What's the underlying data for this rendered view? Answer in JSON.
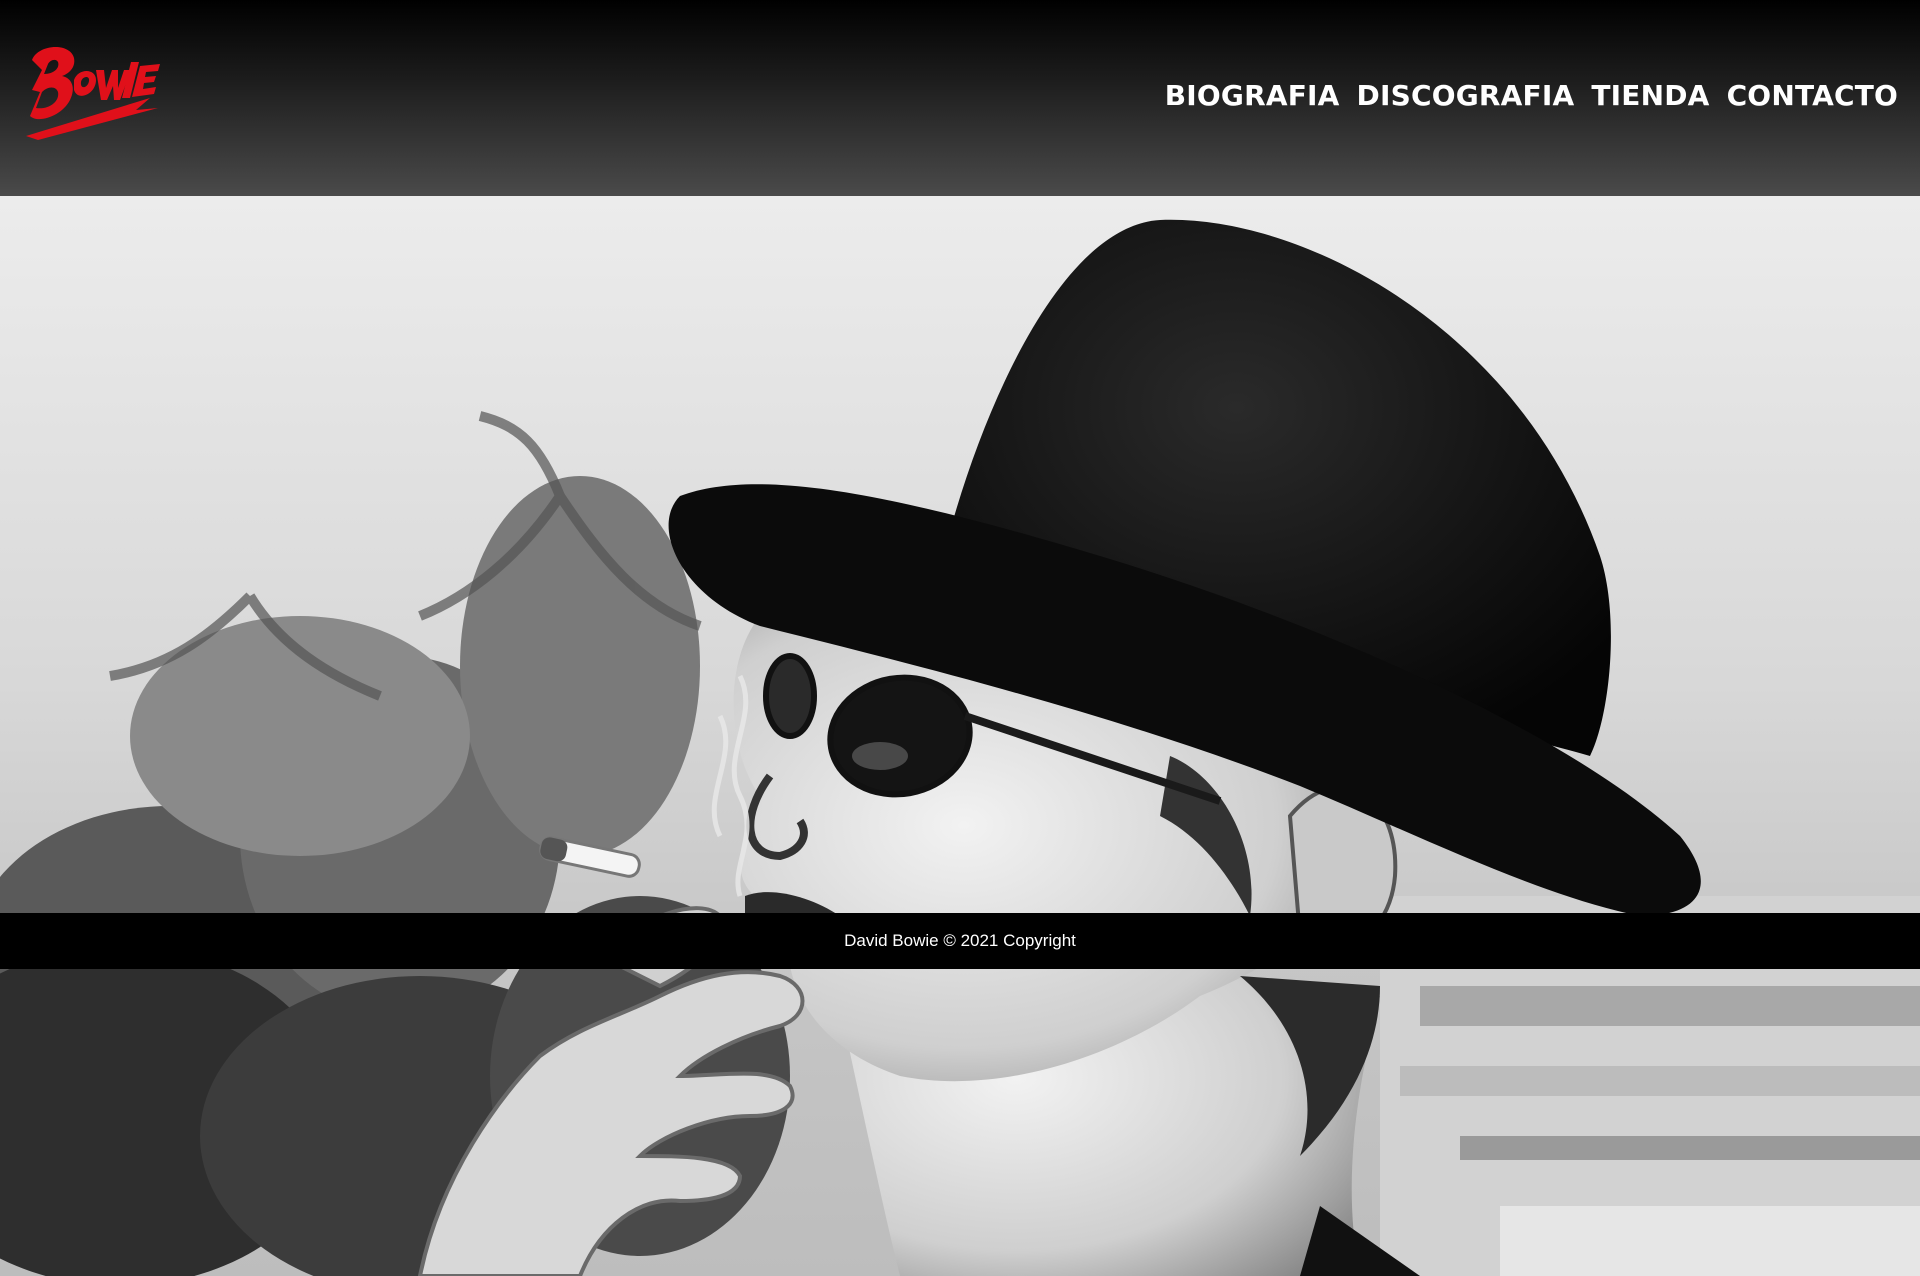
{
  "header": {
    "logo_text": "BOWIE",
    "nav": [
      {
        "label": "BIOGRAFIA"
      },
      {
        "label": "DISCOGRAFIA"
      },
      {
        "label": "TIENDA"
      },
      {
        "label": "CONTACTO"
      }
    ]
  },
  "hero": {
    "icon": "hero-photo"
  },
  "footer": {
    "copyright": "David Bowie © 2021 Copyright"
  },
  "colors": {
    "logo_red": "#e0101a",
    "header_top": "#000000",
    "header_bottom": "#4a4a4a",
    "footer_bg": "#000000",
    "text": "#ffffff"
  }
}
